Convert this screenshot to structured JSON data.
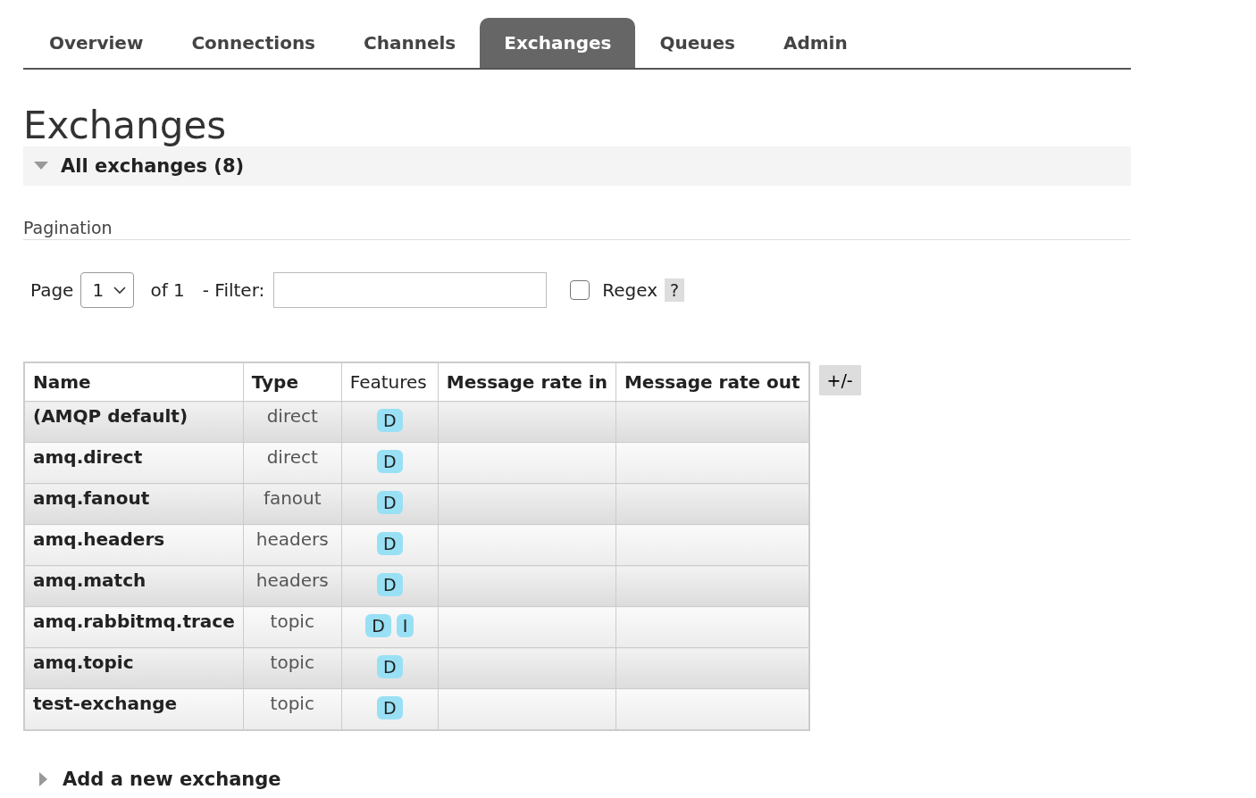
{
  "tabs": [
    {
      "label": "Overview",
      "selected": false
    },
    {
      "label": "Connections",
      "selected": false
    },
    {
      "label": "Channels",
      "selected": false
    },
    {
      "label": "Exchanges",
      "selected": true
    },
    {
      "label": "Queues",
      "selected": false
    },
    {
      "label": "Admin",
      "selected": false
    }
  ],
  "page_title": "Exchanges",
  "section": {
    "title": "All exchanges (8)",
    "expanded": true
  },
  "pagination": {
    "heading": "Pagination",
    "page_label": "Page",
    "page_value": "1",
    "of_text": "of 1",
    "filter_label": "- Filter:",
    "regex": {
      "label": "Regex",
      "checked": false
    },
    "help": "?"
  },
  "table": {
    "columns": [
      {
        "label": "Name",
        "bold": true
      },
      {
        "label": "Type",
        "bold": true
      },
      {
        "label": "Features",
        "bold": false
      },
      {
        "label": "Message rate in",
        "bold": true
      },
      {
        "label": "Message rate out",
        "bold": true
      }
    ],
    "rows": [
      {
        "name": "(AMQP default)",
        "type": "direct",
        "features": [
          "D"
        ]
      },
      {
        "name": "amq.direct",
        "type": "direct",
        "features": [
          "D"
        ]
      },
      {
        "name": "amq.fanout",
        "type": "fanout",
        "features": [
          "D"
        ]
      },
      {
        "name": "amq.headers",
        "type": "headers",
        "features": [
          "D"
        ]
      },
      {
        "name": "amq.match",
        "type": "headers",
        "features": [
          "D"
        ]
      },
      {
        "name": "amq.rabbitmq.trace",
        "type": "topic",
        "features": [
          "D",
          "I"
        ]
      },
      {
        "name": "amq.topic",
        "type": "topic",
        "features": [
          "D"
        ]
      },
      {
        "name": "test-exchange",
        "type": "topic",
        "features": [
          "D"
        ]
      }
    ]
  },
  "columns_toggle": "+/-",
  "add_section": {
    "title": "Add a new exchange",
    "expanded": false
  }
}
